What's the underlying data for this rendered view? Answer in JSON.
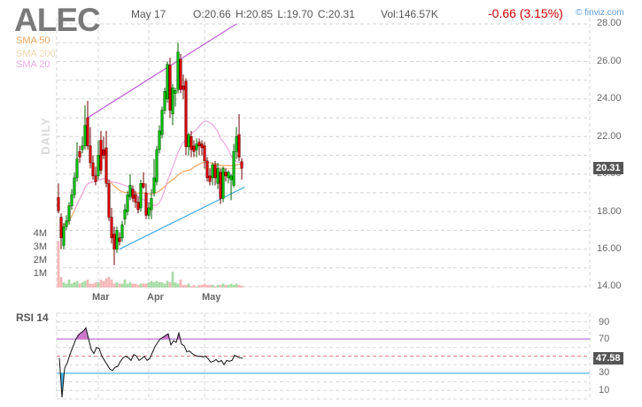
{
  "header": {
    "ticker": "ALEC",
    "date": "May 17",
    "ohlc": "O:20.66  H:20.85  L:19.70  C:20.31",
    "volume": "Vol:146.57K",
    "change": "-0.66 (3.15%)",
    "brand": "finviz.com"
  },
  "legend": {
    "sma50": "SMA 50",
    "sma200": "SMA 200",
    "sma20": "SMA 20"
  },
  "colors": {
    "sma50": "#f5a55a",
    "sma200": "#f3d9a8",
    "sma20": "#f0a6e0",
    "up": "#00c000",
    "down": "#dd0000",
    "rsi_over": "#cc77cc",
    "rsi_under": "#4ab3e8"
  },
  "period_label": "DAILY",
  "last_price_label": "20.31",
  "volume_axis": [
    "4M",
    "3M",
    "2M",
    "1M"
  ],
  "chart_data": [
    {
      "type": "candlestick",
      "title": "ALEC daily",
      "ylim": [
        14,
        28
      ],
      "yticks": [
        "28.00",
        "26.00",
        "24.00",
        "22.00",
        "20.00",
        "18.00",
        "16.00",
        "14.00"
      ],
      "xticks": [
        "Mar",
        "Apr",
        "May"
      ],
      "xtick_index": [
        15,
        34,
        55
      ],
      "candles": [
        [
          18.75,
          19.5,
          17.9,
          18.05
        ],
        [
          17.7,
          17.9,
          16.0,
          16.6
        ],
        [
          16.2,
          17.4,
          16.0,
          17.2
        ],
        [
          17.2,
          17.8,
          17.0,
          17.5
        ],
        [
          17.5,
          18.5,
          17.3,
          18.3
        ],
        [
          18.3,
          19.2,
          18.1,
          18.9
        ],
        [
          18.9,
          20.1,
          18.7,
          19.8
        ],
        [
          19.8,
          21.7,
          19.6,
          20.8
        ],
        [
          21.2,
          21.5,
          20.6,
          20.9
        ],
        [
          21.3,
          22.0,
          21.1,
          21.5
        ],
        [
          21.5,
          23.65,
          21.3,
          22.6
        ],
        [
          23.0,
          23.9,
          21.3,
          21.5
        ],
        [
          21.5,
          22.5,
          20.3,
          20.6
        ],
        [
          20.6,
          21.0,
          19.7,
          19.9
        ],
        [
          19.9,
          20.4,
          19.4,
          19.6
        ],
        [
          19.9,
          21.8,
          19.7,
          21.0
        ],
        [
          21.8,
          22.3,
          20.0,
          20.2
        ],
        [
          21.3,
          22.0,
          20.8,
          21.0
        ],
        [
          21.4,
          22.3,
          19.3,
          19.5
        ],
        [
          19.5,
          19.7,
          17.5,
          17.7
        ],
        [
          17.7,
          18.2,
          16.3,
          16.6
        ],
        [
          16.8,
          17.2,
          15.15,
          16.0
        ],
        [
          16.0,
          17.2,
          15.8,
          17.0
        ],
        [
          16.6,
          16.9,
          16.2,
          16.4
        ],
        [
          16.6,
          17.5,
          16.4,
          17.3
        ],
        [
          17.6,
          18.4,
          17.3,
          18.1
        ],
        [
          18.0,
          19.1,
          17.8,
          18.9
        ],
        [
          18.8,
          20.0,
          18.6,
          19.4
        ],
        [
          19.2,
          19.4,
          18.5,
          18.7
        ],
        [
          18.9,
          19.1,
          18.2,
          18.5
        ],
        [
          18.5,
          18.8,
          17.9,
          18.1
        ],
        [
          18.2,
          19.7,
          18.0,
          19.5
        ],
        [
          19.5,
          20.1,
          19.2,
          19.3
        ],
        [
          19.0,
          19.5,
          17.6,
          17.8
        ],
        [
          17.8,
          18.5,
          17.6,
          18.2
        ],
        [
          18.1,
          19.2,
          17.6,
          18.7
        ],
        [
          19.0,
          20.8,
          18.8,
          19.8
        ],
        [
          19.6,
          21.5,
          19.4,
          21.3
        ],
        [
          21.3,
          22.6,
          21.1,
          22.3
        ],
        [
          22.1,
          23.6,
          21.9,
          23.4
        ],
        [
          23.4,
          24.6,
          23.2,
          24.4
        ],
        [
          24.0,
          26.0,
          23.8,
          25.85
        ],
        [
          25.8,
          26.2,
          23.0,
          23.4
        ],
        [
          23.2,
          24.8,
          22.6,
          24.6
        ],
        [
          24.3,
          24.6,
          23.6,
          24.45
        ],
        [
          24.5,
          27.0,
          24.3,
          26.5
        ],
        [
          26.1,
          26.4,
          24.3,
          24.5
        ],
        [
          24.7,
          25.3,
          24.0,
          24.5
        ],
        [
          24.95,
          25.1,
          21.0,
          21.45
        ],
        [
          21.45,
          22.2,
          21.0,
          22.1
        ],
        [
          22.0,
          22.3,
          20.9,
          21.3
        ],
        [
          21.5,
          21.8,
          20.9,
          21.2
        ],
        [
          21.3,
          21.9,
          20.9,
          21.6
        ],
        [
          21.7,
          21.9,
          21.0,
          21.5
        ],
        [
          21.6,
          21.8,
          21.0,
          21.4
        ],
        [
          21.5,
          21.7,
          20.3,
          20.7
        ],
        [
          20.7,
          20.9,
          19.6,
          19.8
        ],
        [
          19.9,
          20.3,
          19.4,
          19.6
        ],
        [
          19.8,
          20.6,
          19.4,
          20.5
        ],
        [
          20.5,
          20.7,
          19.4,
          19.8
        ],
        [
          19.5,
          20.6,
          19.2,
          20.3
        ],
        [
          20.1,
          20.3,
          18.4,
          18.7
        ],
        [
          18.7,
          20.4,
          18.5,
          20.3
        ],
        [
          20.1,
          20.3,
          19.6,
          19.9
        ],
        [
          19.8,
          20.2,
          19.5,
          20.1
        ],
        [
          19.7,
          20.0,
          18.6,
          19.9
        ],
        [
          19.4,
          21.6,
          19.3,
          21.2
        ],
        [
          21.2,
          22.5,
          20.8,
          22.0
        ],
        [
          22.1,
          23.2,
          20.7,
          20.9
        ],
        [
          20.66,
          20.85,
          19.7,
          20.31
        ]
      ],
      "volume_m": [
        3.5,
        0.8,
        0.4,
        0.3,
        0.6,
        0.3,
        0.4,
        0.5,
        0.3,
        0.4,
        0.5,
        0.6,
        0.3,
        0.3,
        0.4,
        0.4,
        0.6,
        0.5,
        0.7,
        0.8,
        0.6,
        0.3,
        0.4,
        0.3,
        0.3,
        0.6,
        0.3,
        0.4,
        0.3,
        0.3,
        0.2,
        0.3,
        0.3,
        0.3,
        0.4,
        0.5,
        0.4,
        0.5,
        0.4,
        0.4,
        0.3,
        0.5,
        0.4,
        1.2,
        0.4,
        0.3,
        0.6,
        0.2,
        0.2,
        0.3,
        0.1,
        0.2,
        0.1,
        0.2,
        0.2,
        0.3,
        0.2,
        0.2,
        0.2,
        0.1,
        0.2,
        0.2,
        0.3,
        0.2,
        0.2,
        0.3,
        0.2,
        0.3,
        0.2,
        0.15
      ],
      "sma200": [
        20.3,
        20.3,
        20.3,
        20.3,
        20.3,
        20.3,
        20.35,
        20.35,
        20.3,
        20.3,
        20.3,
        20.3,
        20.3,
        20.3,
        20.3
      ],
      "sma200_start_index": 55,
      "trendlines": [
        {
          "name": "resistance",
          "from": [
            11,
            23.0
          ],
          "to": [
            67,
            28.0
          ],
          "color": "#c05ad8"
        },
        {
          "name": "support",
          "from": [
            23,
            16.0
          ],
          "to": [
            70,
            19.3
          ],
          "color": "#3aa8e0"
        }
      ]
    },
    {
      "type": "line",
      "title": "RSI 14",
      "ylim": [
        0,
        100
      ],
      "yticks": [
        "90",
        "70",
        "30",
        "10"
      ],
      "overbought": 70,
      "oversold": 30,
      "last_value_label": "47.58",
      "values": [
        48,
        2,
        36,
        42,
        52,
        60,
        68,
        74,
        77,
        79,
        83,
        70,
        58,
        53,
        60,
        59,
        50,
        45,
        40,
        35,
        33,
        37,
        38,
        44,
        48,
        50,
        48,
        45,
        52,
        50,
        45,
        47,
        50,
        45,
        47,
        54,
        61,
        66,
        70,
        72,
        74,
        76,
        63,
        68,
        66,
        77,
        64,
        62,
        55,
        56,
        53,
        51,
        50,
        50,
        49,
        50,
        47,
        43,
        44,
        46,
        43,
        45,
        40,
        45,
        44,
        45,
        51,
        49,
        48,
        47.58
      ]
    }
  ]
}
